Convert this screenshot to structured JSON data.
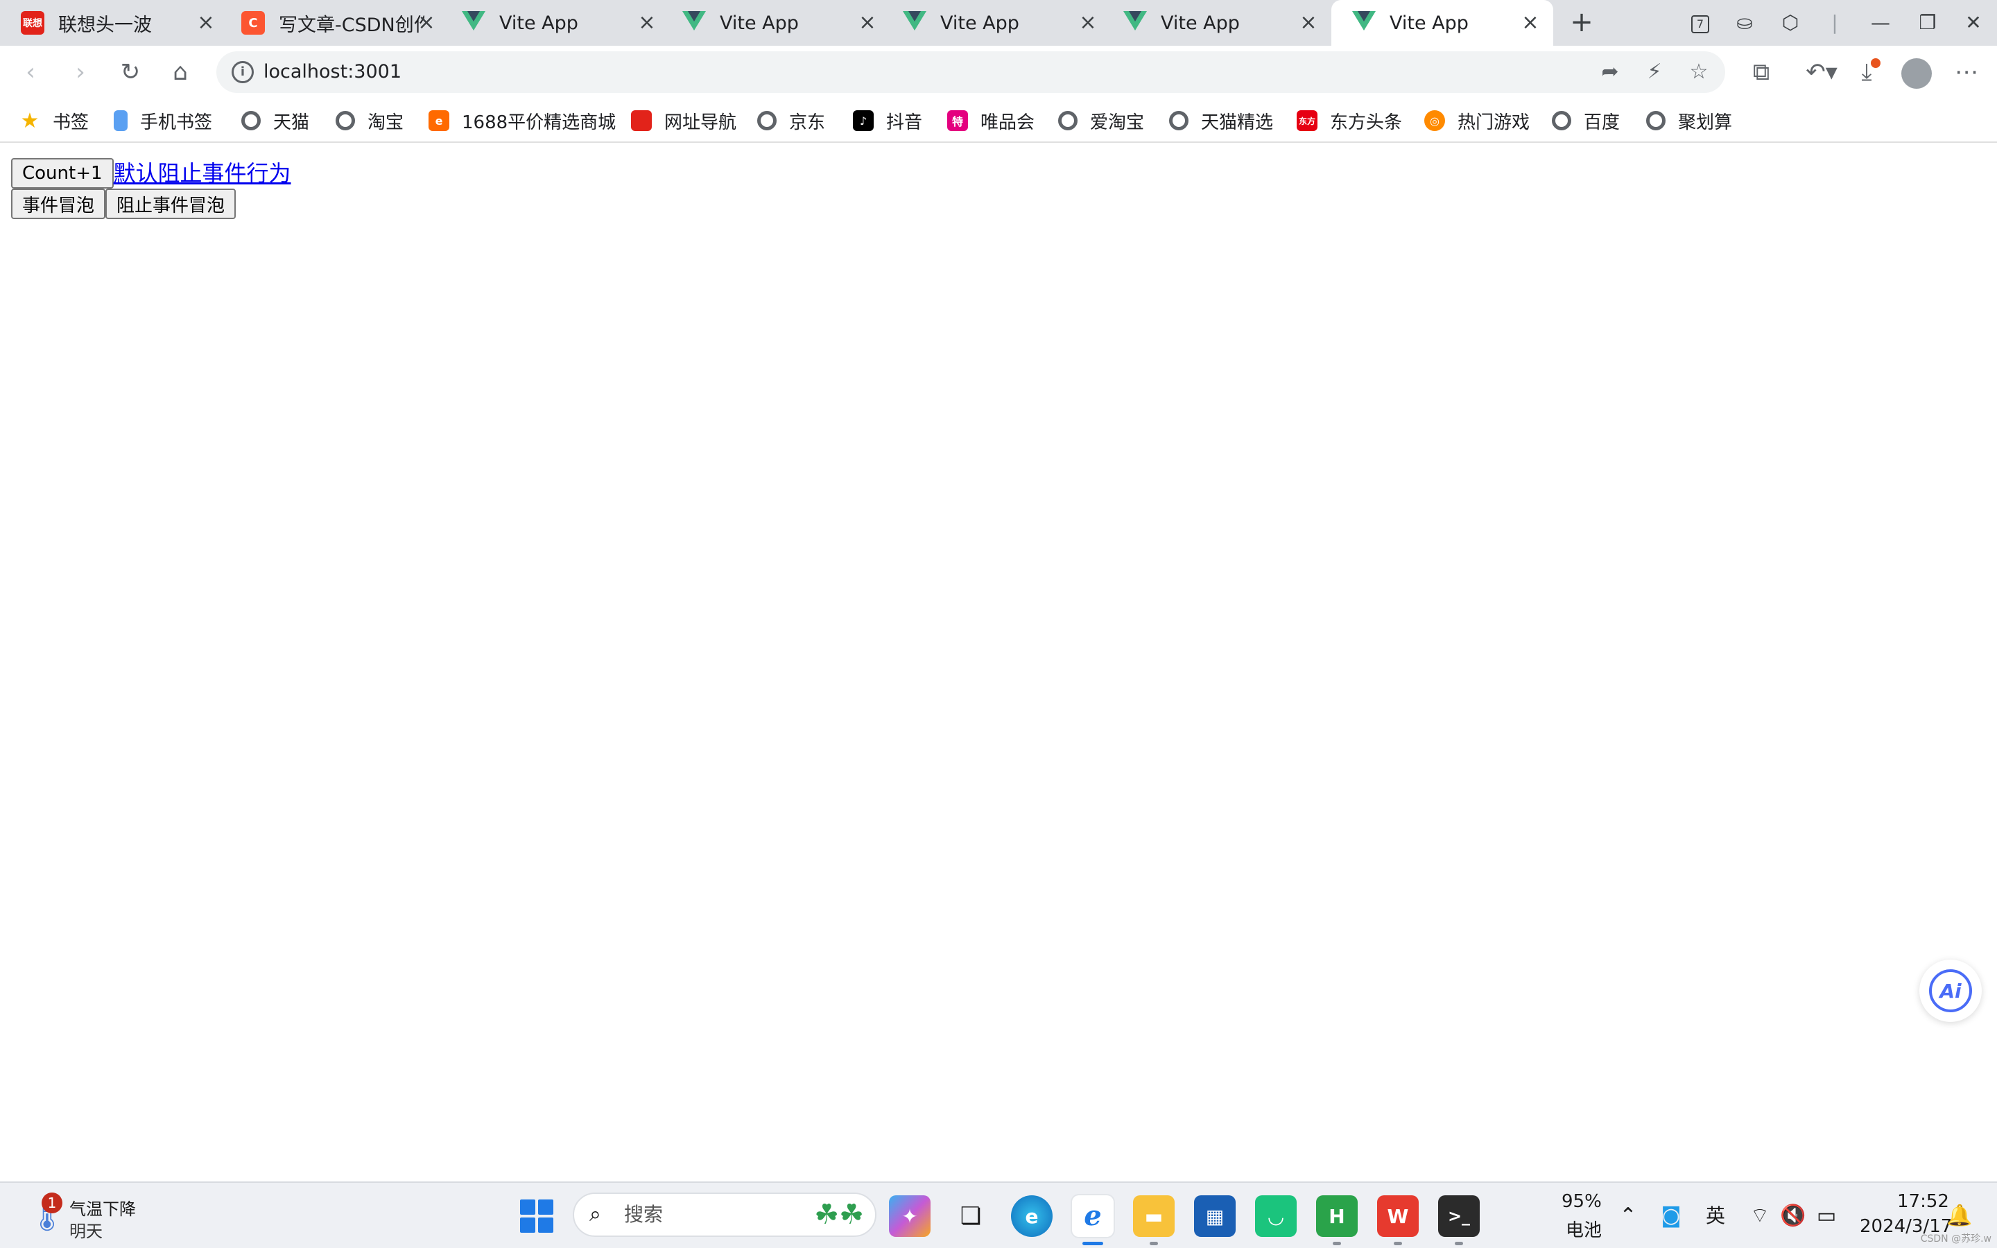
{
  "tabs": [
    {
      "title": "联想头一波",
      "favicon": "lenovo-favicon",
      "favicon_text": "联想",
      "color": "#e2231a",
      "active": false
    },
    {
      "title": "写文章-CSDN创作",
      "favicon": "csdn-favicon",
      "favicon_text": "C",
      "color": "#fc5531",
      "active": false
    },
    {
      "title": "Vite App",
      "favicon": "vue-favicon",
      "active": false
    },
    {
      "title": "Vite App",
      "favicon": "vue-favicon",
      "active": false
    },
    {
      "title": "Vite App",
      "favicon": "vue-favicon",
      "active": false
    },
    {
      "title": "Vite App",
      "favicon": "vue-favicon",
      "active": false
    },
    {
      "title": "Vite App",
      "favicon": "vue-favicon",
      "active": true
    }
  ],
  "toolbar": {
    "url": "localhost:3001"
  },
  "bookmarks": [
    {
      "label": "书签",
      "icon": "star-icon"
    },
    {
      "label": "手机书签",
      "icon": "phone-icon"
    },
    {
      "label": "天猫",
      "icon": "browser-e-icon"
    },
    {
      "label": "淘宝",
      "icon": "browser-e-icon"
    },
    {
      "label": "1688平价精选商城",
      "icon": "1688-icon"
    },
    {
      "label": "网址导航",
      "icon": "lenovo-icon"
    },
    {
      "label": "京东",
      "icon": "browser-e-icon"
    },
    {
      "label": "抖音",
      "icon": "douyin-icon"
    },
    {
      "label": "唯品会",
      "icon": "vip-icon",
      "icon_text": "特"
    },
    {
      "label": "爱淘宝",
      "icon": "browser-e-icon"
    },
    {
      "label": "天猫精选",
      "icon": "browser-e-icon"
    },
    {
      "label": "东方头条",
      "icon": "dongfang-icon",
      "icon_text": "东方"
    },
    {
      "label": "热门游戏",
      "icon": "game-icon"
    },
    {
      "label": "百度",
      "icon": "browser-e-icon"
    },
    {
      "label": "聚划算",
      "icon": "browser-e-icon"
    }
  ],
  "page": {
    "count_button": "Count+1",
    "prevent_default_link": "默认阻止事件行为",
    "bubble_button": "事件冒泡",
    "stop_bubble_button": "阻止事件冒泡",
    "ai_button": "Ai"
  },
  "taskbar": {
    "weather_badge": "1",
    "weather_title": "气温下降",
    "weather_sub": "明天",
    "search_placeholder": "搜索",
    "battery_percent": "95%",
    "battery_label": "电池",
    "ime": "英",
    "time": "17:52",
    "date": "2024/3/17",
    "watermark": "CSDN @苏珍.w"
  },
  "colors": {
    "accent": "#1f7ae6",
    "link": "#0000ee",
    "tabstrip": "#dfe1e5"
  }
}
